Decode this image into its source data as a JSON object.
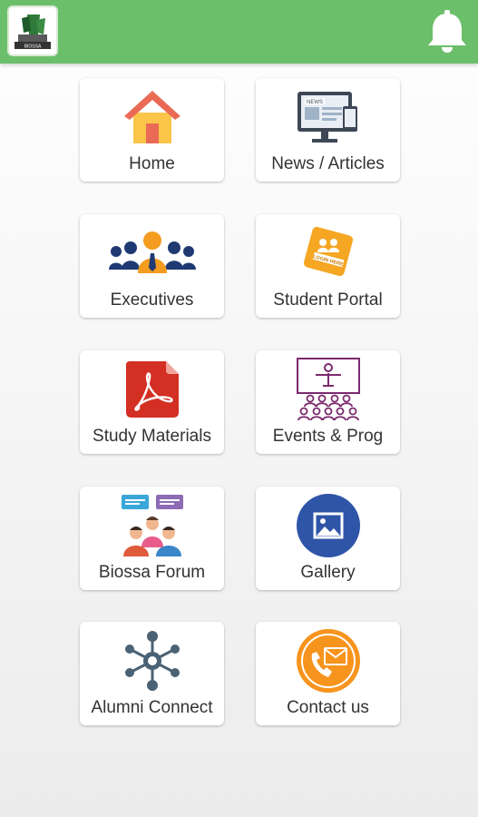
{
  "appbar": {
    "logo_icon": "association-logo",
    "logo_text": "BIOSSA",
    "notification_icon": "bell-icon",
    "color": "#6cbf6a"
  },
  "menu": [
    {
      "label": "Home",
      "icon": "home-icon"
    },
    {
      "label": "News / Articles",
      "icon": "newspaper-monitor-icon"
    },
    {
      "label": "Executives",
      "icon": "team-icon"
    },
    {
      "label": "Student Portal",
      "icon": "login-icon",
      "icon_text": "LOGIN HERE"
    },
    {
      "label": "Study Materials",
      "icon": "pdf-icon"
    },
    {
      "label": "Events & Prog",
      "icon": "presentation-icon"
    },
    {
      "label": "Biossa Forum",
      "icon": "forum-icon"
    },
    {
      "label": "Gallery",
      "icon": "image-icon"
    },
    {
      "label": "Alumni Connect",
      "icon": "network-icon"
    },
    {
      "label": "Contact us",
      "icon": "contact-mail-icon"
    }
  ]
}
